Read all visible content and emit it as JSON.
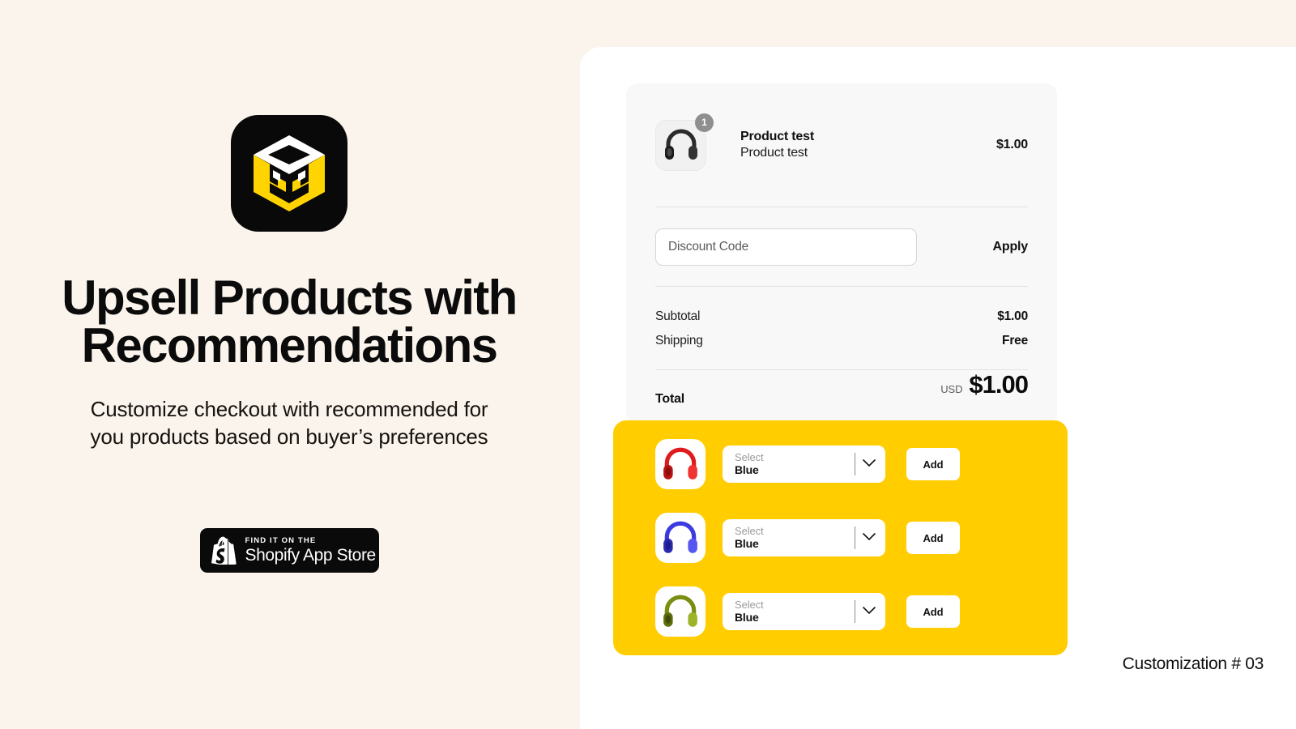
{
  "colors": {
    "cream_background": "#faf4ec",
    "panel_white": "#ffffff",
    "accent_yellow": "#ffcd00",
    "logo_black": "#090909",
    "card_gray": "#f8f8f8",
    "badge_gray": "#8f8f8f"
  },
  "hero": {
    "logo_alt": "app-logo-cube",
    "title": "Upsell Products with Recommendations",
    "subtitle": "Customize checkout with recommended for you products based on buyer’s preferences",
    "badge": {
      "eyebrow": "FIND IT ON THE",
      "label": "Shopify App Store",
      "icon": "shopify-bag-icon"
    }
  },
  "checkout": {
    "line_item": {
      "quantity_badge": "1",
      "thumbnail": "black-headphones-thumbnail",
      "title": "Product test",
      "variant": "Product test",
      "price": "$1.00"
    },
    "discount": {
      "placeholder": "Discount Code",
      "value": "",
      "apply_label": "Apply"
    },
    "totals": [
      {
        "label": "Subtotal",
        "value": "$1.00"
      },
      {
        "label": "Shipping",
        "value": "Free"
      }
    ],
    "grand_total": {
      "label": "Total",
      "currency": "USD",
      "amount": "$1.00"
    }
  },
  "upsell": {
    "rows": [
      {
        "thumbnail": "red-headphones-thumbnail",
        "select_label": "Select",
        "select_value": "Blue",
        "chevron": "chevron-down-icon",
        "add_label": "Add"
      },
      {
        "thumbnail": "blue-headphones-thumbnail",
        "select_label": "Select",
        "select_value": "Blue",
        "chevron": "chevron-down-icon",
        "add_label": "Add"
      },
      {
        "thumbnail": "green-headphones-thumbnail",
        "select_label": "Select",
        "select_value": "Blue",
        "chevron": "chevron-down-icon",
        "add_label": "Add"
      }
    ]
  },
  "caption": "Customization # 03"
}
